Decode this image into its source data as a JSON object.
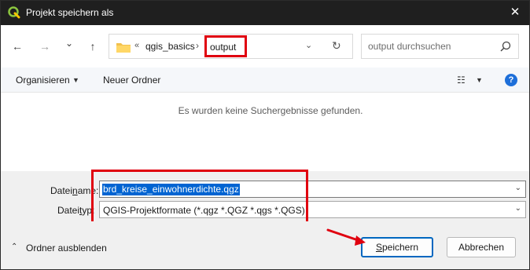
{
  "window": {
    "title": "Projekt speichern als",
    "close_glyph": "✕",
    "app_icon": "qgis-icon"
  },
  "navigation": {
    "back_glyph": "←",
    "forward_glyph": "→",
    "recent_glyph": "⌄",
    "up_glyph": "↑",
    "breadcrumb": {
      "separator_lead": "«",
      "items": [
        "qgis_basics",
        "output"
      ],
      "separator": "›"
    },
    "dropdown_glyph": "⌄",
    "refresh_glyph": "↻",
    "search_placeholder": "output durchsuchen"
  },
  "toolbar": {
    "organize_label": "Organisieren",
    "caret": "▼",
    "new_folder_label": "Neuer Ordner",
    "view_glyph": "☷",
    "help_glyph": "?"
  },
  "content": {
    "empty_message": "Es wurden keine Suchergebnisse gefunden."
  },
  "fields": {
    "filename_label_pre": "Datei",
    "filename_label_ul": "n",
    "filename_label_post": "ame:",
    "filename_value": "brd_kreise_einwohnerdichte.qgz",
    "filetype_label_pre": "Datei",
    "filetype_label_ul": "t",
    "filetype_label_post": "yp:",
    "filetype_value": "QGIS-Projektformate (*.qgz *.QGZ *.qgs *.QGS)",
    "caret": "⌄"
  },
  "footer": {
    "hide_caret": "⌃",
    "hide_folders_label": "Ordner ausblenden",
    "save_label_ul": "S",
    "save_label_rest": "peichern",
    "cancel_label": "Abbrechen"
  },
  "colors": {
    "annotation_red": "#e0000f",
    "selection_blue": "#0064d2",
    "primary_border": "#0067c0",
    "titlebar_bg": "#1f1f1f"
  }
}
